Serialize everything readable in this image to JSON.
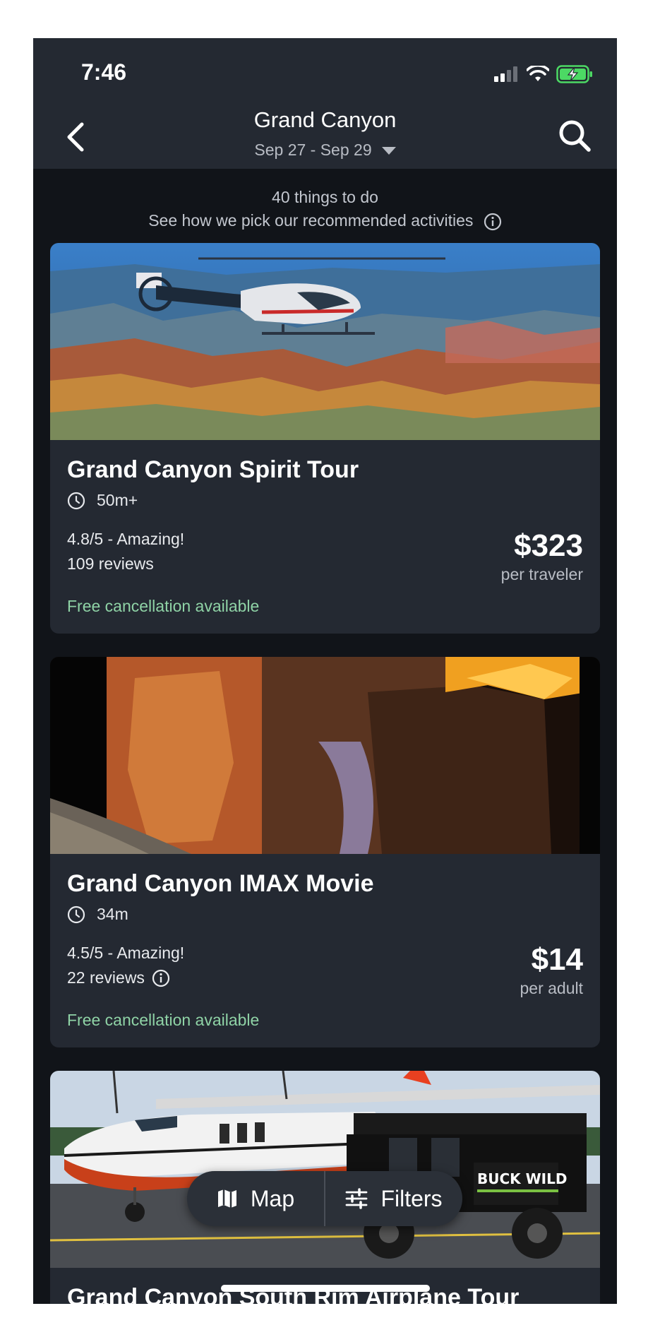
{
  "status_bar": {
    "time": "7:46"
  },
  "header": {
    "title": "Grand Canyon",
    "date_range": "Sep 27 - Sep 29"
  },
  "summary": {
    "count_text": "40 things to do",
    "recommend_text": "See how we pick our recommended activities"
  },
  "activities": [
    {
      "title": "Grand Canyon Spirit Tour",
      "duration": "50m+",
      "rating": "4.8/5 - Amazing!",
      "reviews": "109 reviews",
      "price": "$323",
      "price_unit": "per traveler",
      "cancellation": "Free cancellation available"
    },
    {
      "title": "Grand Canyon IMAX Movie",
      "duration": "34m",
      "rating": "4.5/5 - Amazing!",
      "reviews": "22 reviews",
      "price": "$14",
      "price_unit": "per adult",
      "cancellation": "Free cancellation available"
    },
    {
      "title": "Grand Canyon South Rim Airplane Tour"
    }
  ],
  "floating_actions": {
    "map_label": "Map",
    "filters_label": "Filters"
  },
  "colors": {
    "background": "#111419",
    "card": "#242932",
    "accent_green": "#8fd3a6",
    "battery_green": "#4cd964"
  },
  "icons": [
    "back-arrow-icon",
    "search-icon",
    "info-icon",
    "clock-icon",
    "map-icon",
    "filters-icon",
    "signal-icon",
    "wifi-icon",
    "battery-charging-icon"
  ]
}
